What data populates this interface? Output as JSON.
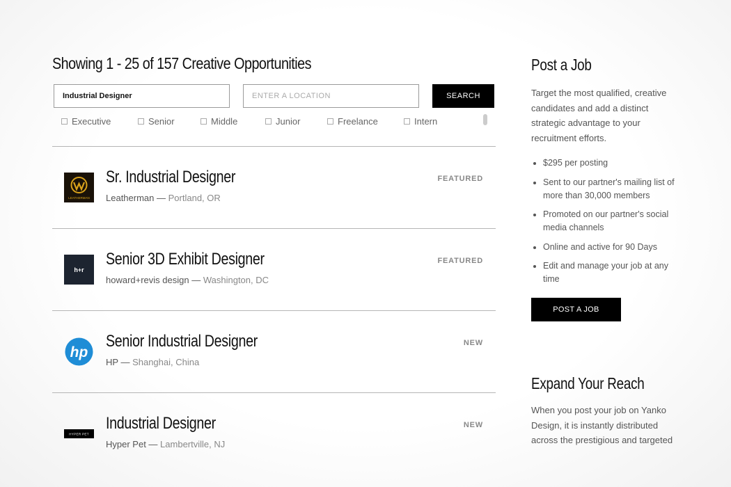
{
  "results_heading": "Showing 1 - 25 of 157 Creative Opportunities",
  "search": {
    "keyword_value": "Industrial Designer",
    "location_placeholder": "ENTER A LOCATION",
    "button_label": "SEARCH"
  },
  "filters": [
    "Executive",
    "Senior",
    "Middle",
    "Junior",
    "Freelance",
    "Intern"
  ],
  "jobs": [
    {
      "title": "Sr. Industrial Designer",
      "company": "Leatherman",
      "location": "Portland, OR",
      "tag": "FEATURED",
      "logo": "leatherman-logo",
      "logo_text": "LEATHERMAN"
    },
    {
      "title": "Senior 3D Exhibit Designer",
      "company": "howard+revis design",
      "location": "Washington, DC",
      "tag": "FEATURED",
      "logo": "howard-revis-logo",
      "logo_text": "h+r"
    },
    {
      "title": "Senior Industrial Designer",
      "company": "HP",
      "location": "Shanghai, China",
      "tag": "NEW",
      "logo": "hp-logo",
      "logo_text": "hp"
    },
    {
      "title": "Industrial Designer",
      "company": "Hyper Pet",
      "location": "Lambertville, NJ",
      "tag": "NEW",
      "logo": "hyper-pet-logo",
      "logo_text": "HYPER PET"
    }
  ],
  "sidebar": {
    "post_title": "Post a Job",
    "post_desc": "Target the most qualified, creative candidates and add a distinct strategic advantage to your recruitment efforts.",
    "bullets": [
      "$295 per posting",
      "Sent to our partner's mailing list of more than 30,000 members",
      "Promoted on our partner's social media channels",
      "Online and active for 90 Days",
      "Edit and manage your job at any time"
    ],
    "post_button": "POST A JOB",
    "reach_title": "Expand Your Reach",
    "reach_desc": "When you post your job on Yanko Design, it is instantly distributed across the prestigious and targeted"
  },
  "colors": {
    "accent": "#000000",
    "hp_blue": "#1f8dd6",
    "leatherman_gold": "#d9a21b"
  }
}
